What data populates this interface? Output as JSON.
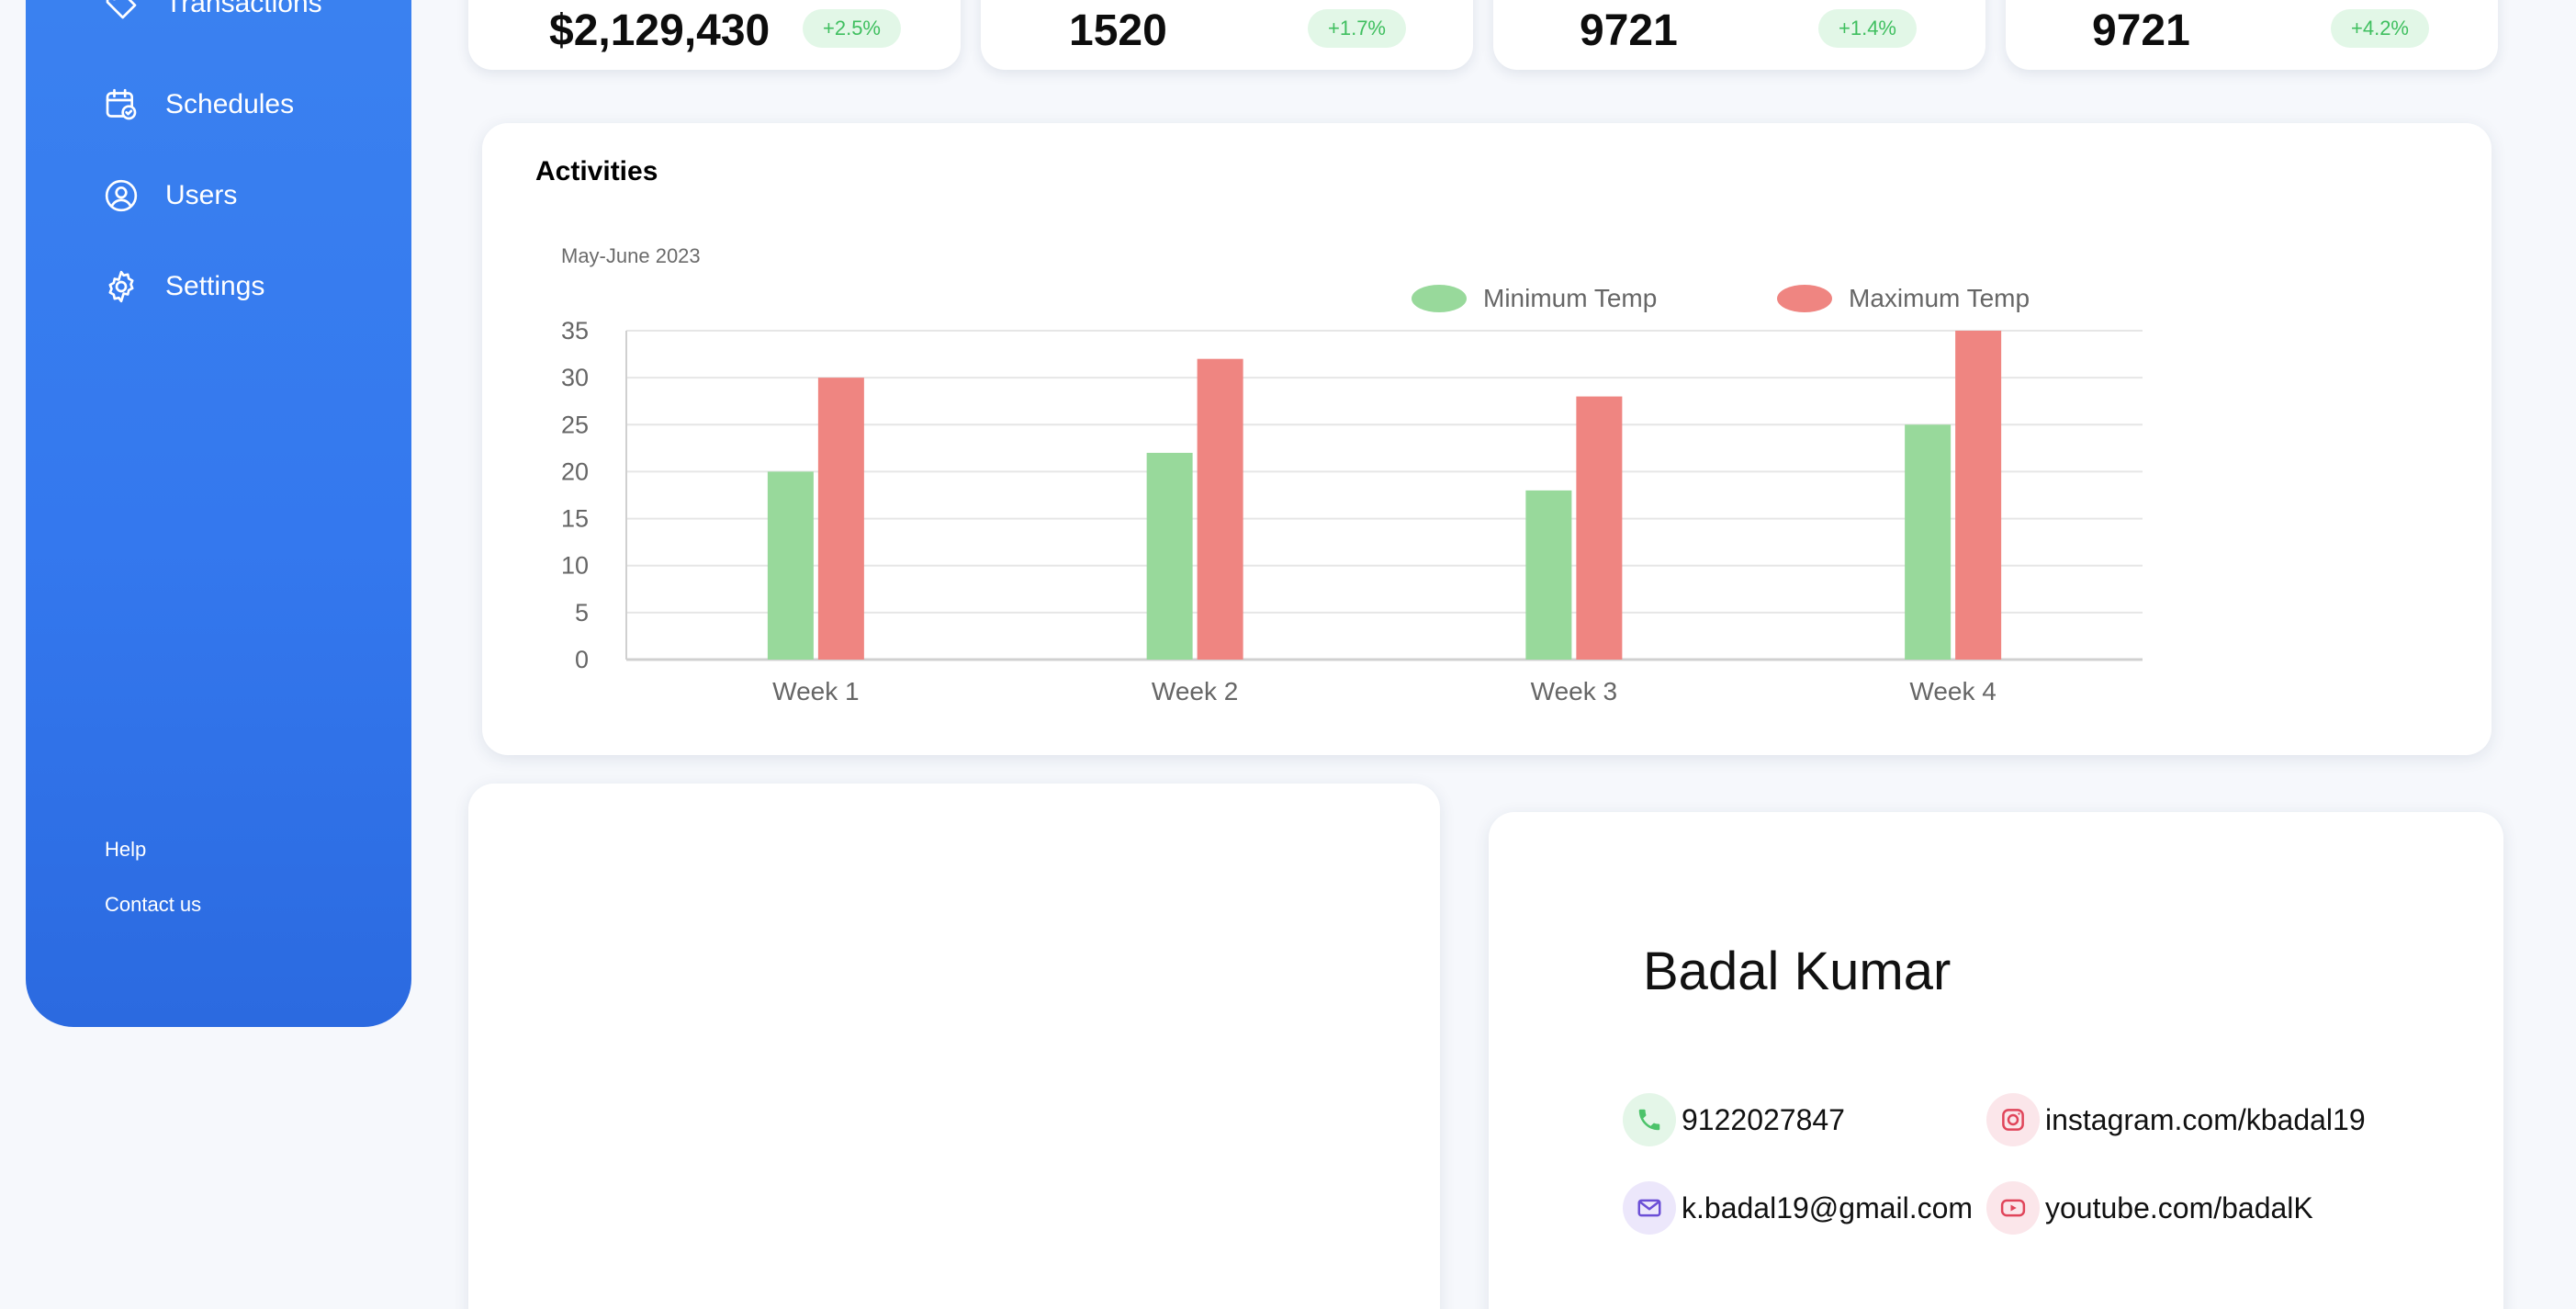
{
  "sidebar": {
    "items": [
      {
        "label": "Transactions",
        "icon": "tag-icon"
      },
      {
        "label": "Schedules",
        "icon": "calendar-icon"
      },
      {
        "label": "Users",
        "icon": "user-circle-icon"
      },
      {
        "label": "Settings",
        "icon": "gear-icon"
      }
    ],
    "footer": {
      "help": "Help",
      "contact": "Contact us"
    }
  },
  "stats": [
    {
      "value": "$2,129,430",
      "change": "+2.5%"
    },
    {
      "value": "1520",
      "change": "+1.7%"
    },
    {
      "value": "9721",
      "change": "+1.4%"
    },
    {
      "value": "9721",
      "change": "+4.2%"
    }
  ],
  "activities": {
    "title": "Activities",
    "subtitle": "May-June 2023"
  },
  "chart_data": {
    "type": "bar",
    "categories": [
      "Week 1",
      "Week 2",
      "Week 3",
      "Week 4"
    ],
    "series": [
      {
        "name": "Minimum Temp",
        "values": [
          20,
          22,
          18,
          25
        ],
        "color": "#98d99b"
      },
      {
        "name": "Maximum Temp",
        "values": [
          30,
          32,
          28,
          35
        ],
        "color": "#ef8581"
      }
    ],
    "yticks": [
      "0",
      "5",
      "10",
      "15",
      "20",
      "25",
      "30",
      "35"
    ],
    "ylim": [
      0,
      35
    ],
    "grid": true,
    "legend": "top-right"
  },
  "profile": {
    "name": "Badal Kumar",
    "phone": "9122027847",
    "email": "k.badal19@gmail.com",
    "instagram": "instagram.com/kbadal19",
    "youtube": "youtube.com/badalK",
    "colors": {
      "phone": "#4cc36a",
      "email": "#6b4fd6",
      "instagram": "#e0455a",
      "youtube": "#e0455a"
    }
  }
}
